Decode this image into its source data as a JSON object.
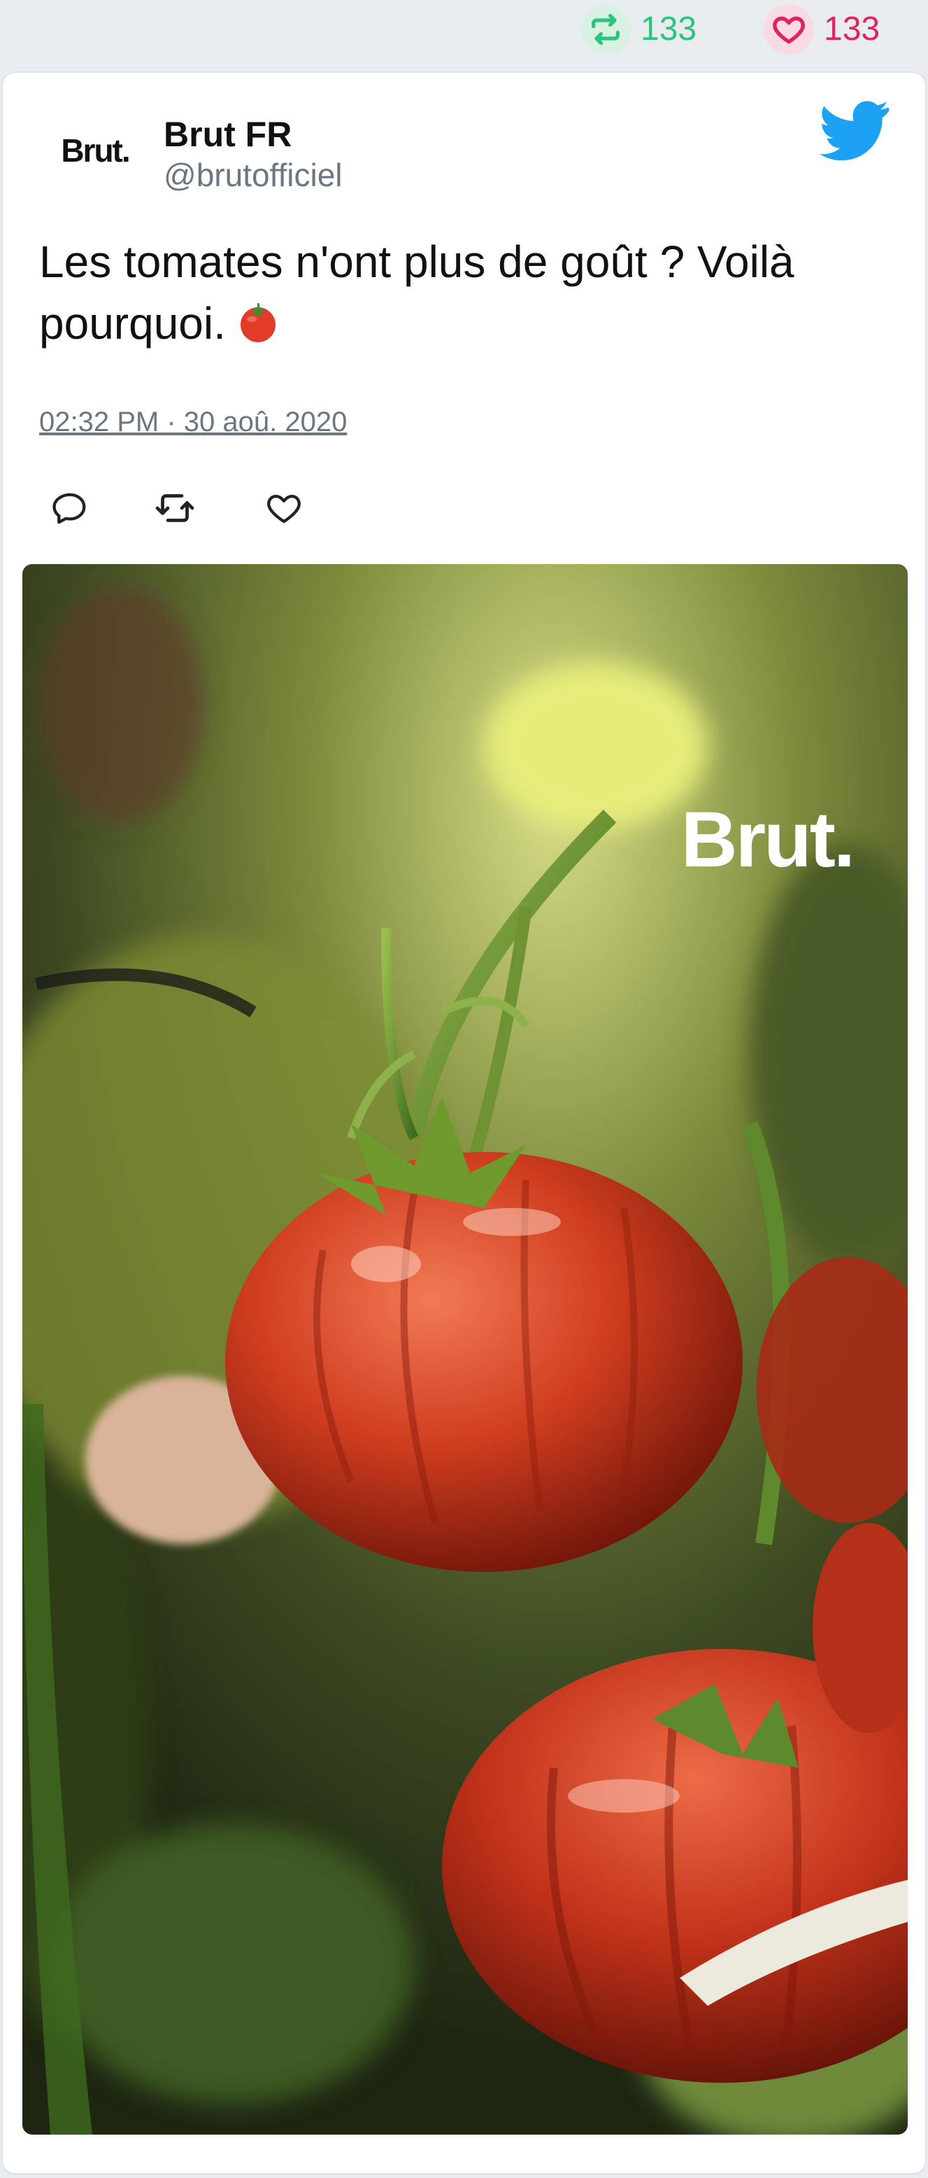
{
  "stats": {
    "retweets": "133",
    "likes": "133"
  },
  "tweet": {
    "author_name": "Brut FR",
    "author_handle": "@brutofficiel",
    "avatar_text": "Brut.",
    "text": "Les tomates n'ont plus de goût ? Voilà pourquoi.",
    "timestamp": "02:32 PM · 30 aoû. 2020"
  },
  "media": {
    "watermark": "Brut."
  },
  "colors": {
    "retweet_green": "#2bc47c",
    "like_pink": "#e0245e",
    "twitter_blue": "#1da1f2",
    "muted_gray": "#6a7681"
  },
  "icons": {
    "retweet": "retweet-icon",
    "like": "heart-icon",
    "reply": "reply-icon",
    "brand": "twitter-bird-icon",
    "emoji": "tomato-emoji"
  }
}
